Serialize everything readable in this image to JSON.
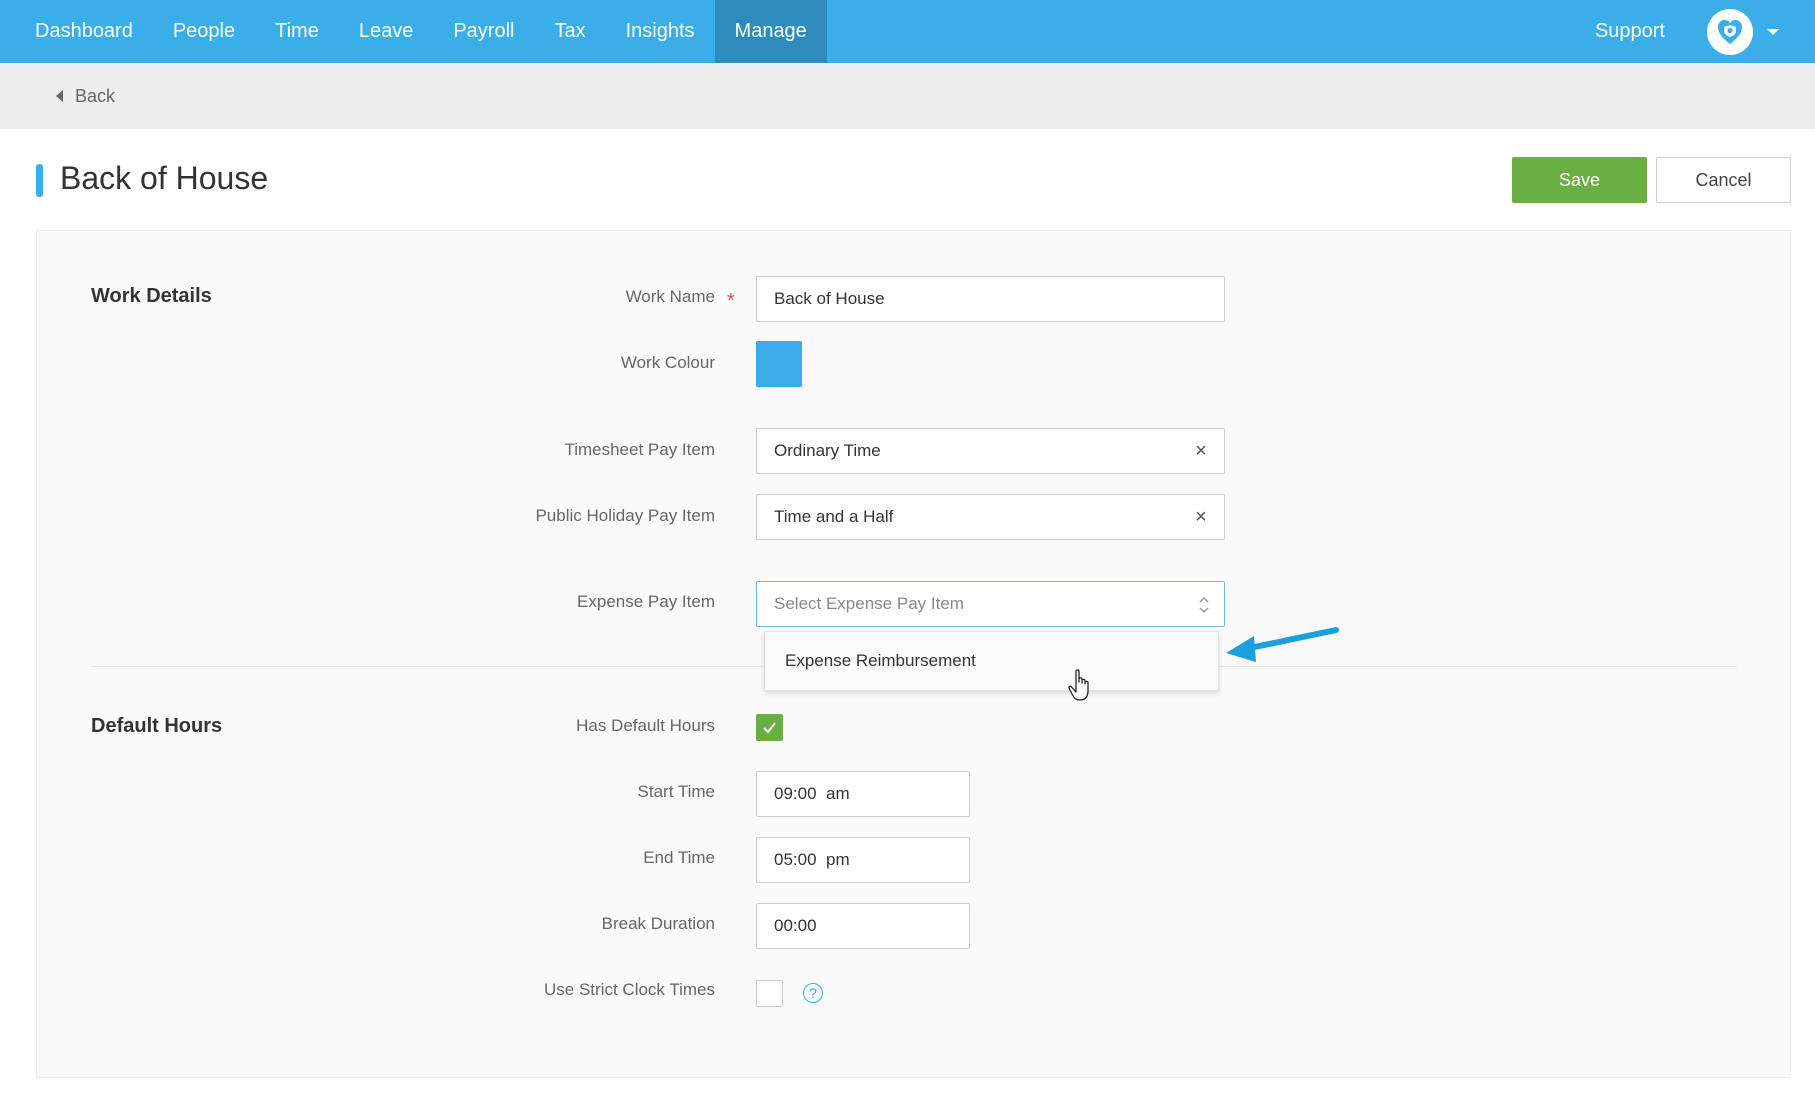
{
  "nav": {
    "items": [
      {
        "label": "Dashboard"
      },
      {
        "label": "People"
      },
      {
        "label": "Time"
      },
      {
        "label": "Leave"
      },
      {
        "label": "Payroll"
      },
      {
        "label": "Tax"
      },
      {
        "label": "Insights"
      },
      {
        "label": "Manage",
        "active": true
      }
    ],
    "support_label": "Support",
    "avatar_icon": "heart-shield-icon",
    "accent_color": "#3aaee8"
  },
  "back": {
    "label": "Back"
  },
  "page": {
    "title": "Back of House"
  },
  "actions": {
    "save_label": "Save",
    "cancel_label": "Cancel",
    "save_color": "#6aaf43"
  },
  "work_details": {
    "section_title": "Work Details",
    "work_name": {
      "label": "Work Name",
      "value": "Back of House",
      "required_mark": "*"
    },
    "work_colour": {
      "label": "Work Colour",
      "value": "#3aaee8"
    },
    "timesheet_pay_item": {
      "label": "Timesheet Pay Item",
      "value": "Ordinary Time"
    },
    "public_holiday_pay_item": {
      "label": "Public Holiday Pay Item",
      "value": "Time and a Half"
    },
    "expense_pay_item": {
      "label": "Expense Pay Item",
      "placeholder": "Select Expense Pay Item",
      "options": [
        "Expense Reimbursement"
      ]
    }
  },
  "default_hours": {
    "section_title": "Default Hours",
    "has_default_hours": {
      "label": "Has Default Hours",
      "checked": true
    },
    "start_time": {
      "label": "Start Time",
      "value": "09:00  am"
    },
    "end_time": {
      "label": "End Time",
      "value": "05:00  pm"
    },
    "break_duration": {
      "label": "Break Duration",
      "value": "00:00"
    },
    "use_strict_clock_times": {
      "label": "Use Strict Clock Times",
      "checked": false,
      "help_icon": "?"
    }
  }
}
